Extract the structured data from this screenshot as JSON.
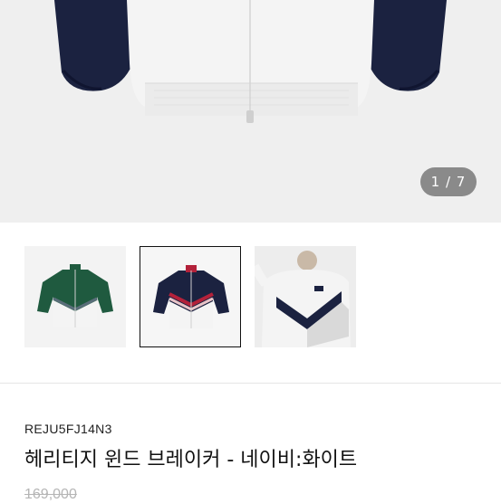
{
  "gallery": {
    "counter": "1 / 7",
    "main_image": "jacket-back-white-navy",
    "thumbnails": [
      {
        "name": "green-white-jacket",
        "selected": false
      },
      {
        "name": "navy-red-white-jacket",
        "selected": true
      },
      {
        "name": "model-wearing-jacket",
        "selected": false
      }
    ]
  },
  "product": {
    "sku": "REJU5FJ14N3",
    "name": "헤리티지 윈드 브레이커 - 네이비:화이트",
    "original_price": "169,000"
  },
  "colors": {
    "navy": "#1b2240",
    "white": "#f4f4f4",
    "green": "#1f5a3f",
    "red": "#b3213a",
    "counter_bg": "#8a8a8a",
    "strike_price": "#b5b5b5"
  }
}
